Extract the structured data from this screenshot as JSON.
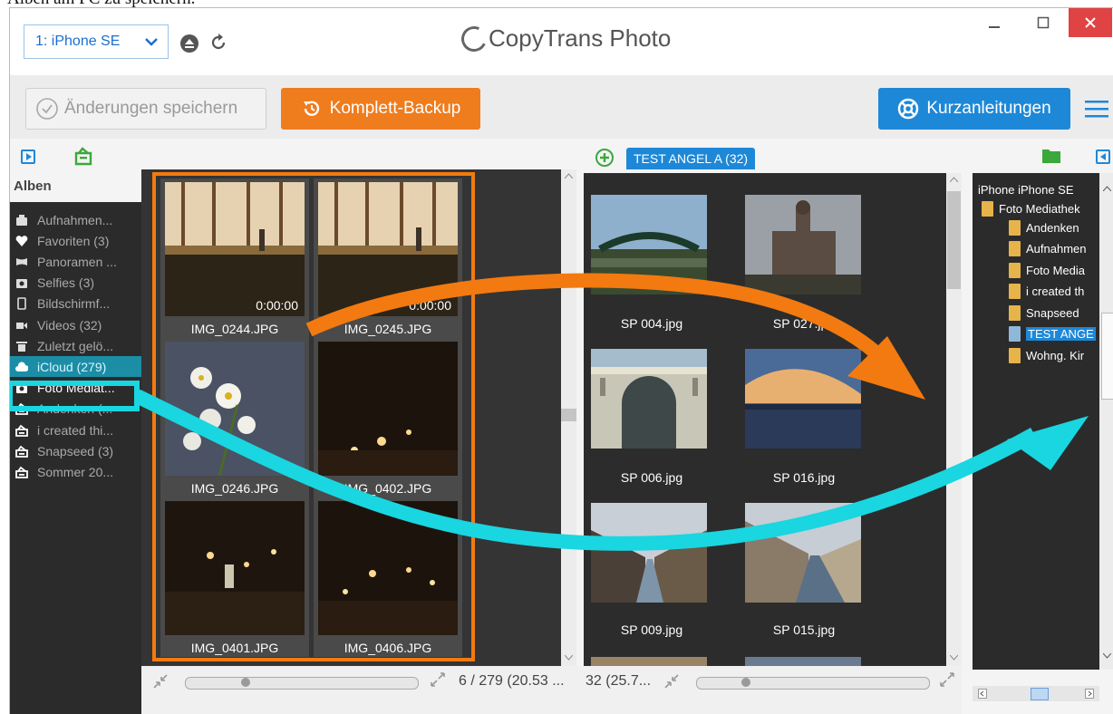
{
  "caption": "Alben am PC zu speichern.",
  "device": {
    "selected": "1: iPhone SE"
  },
  "app_title": "CopyTrans Photo",
  "window_controls": {
    "minimize": "–",
    "maximize": "☐",
    "close": "✕"
  },
  "toolbar": {
    "save_label": "Änderungen speichern",
    "backup_label": "Komplett-Backup",
    "guides_label": "Kurzanleitungen"
  },
  "sidebar": {
    "heading": "Alben",
    "items": [
      {
        "label": "Aufnahmen...",
        "icon": "camera-roll-icon"
      },
      {
        "label": "Favoriten (3)",
        "icon": "heart-icon"
      },
      {
        "label": "Panoramen ...",
        "icon": "panorama-icon"
      },
      {
        "label": "Selfies (3)",
        "icon": "selfie-camera-icon"
      },
      {
        "label": "Bildschirmf...",
        "icon": "phone-screenshot-icon"
      },
      {
        "label": "Videos (32)",
        "icon": "video-camera-icon"
      },
      {
        "label": "Zuletzt gelö...",
        "icon": "trash-icon"
      },
      {
        "label": "iCloud (279)",
        "icon": "cloud-icon"
      },
      {
        "label": "Foto Mediat...",
        "icon": "camera-icon"
      },
      {
        "label": "Andenken (...",
        "icon": "album-icon"
      },
      {
        "label": "i created thi...",
        "icon": "album-icon"
      },
      {
        "label": "Snapseed (3)",
        "icon": "album-icon"
      },
      {
        "label": "Sommer 20...",
        "icon": "album-icon"
      }
    ]
  },
  "left_grid": {
    "thumbs": [
      {
        "name": "IMG_0244.JPG",
        "duration": "0:00:00"
      },
      {
        "name": "IMG_0245.JPG",
        "duration": "0:00:00"
      },
      {
        "name": "IMG_0246.JPG",
        "duration": ""
      },
      {
        "name": "IMG_0402.JPG",
        "duration": ""
      },
      {
        "name": "IMG_0401.JPG",
        "duration": ""
      },
      {
        "name": "IMG_0406.JPG",
        "duration": ""
      }
    ],
    "status": "6 / 279 (20.53 ...",
    "zoom": 0.25
  },
  "right_panel": {
    "tab_label": "TEST ANGEL A (32)",
    "thumbs": [
      {
        "name": "SP 004.jpg"
      },
      {
        "name": "SP 027.jpg"
      },
      {
        "name": "SP 006.jpg"
      },
      {
        "name": "SP 016.jpg"
      },
      {
        "name": "SP 009.jpg"
      },
      {
        "name": "SP 015.jpg"
      }
    ],
    "status": "32 (25.7...",
    "zoom": 0.2
  },
  "tree": {
    "root": "iPhone iPhone SE",
    "library": "Foto Mediathek",
    "albums": [
      "Andenken",
      "Aufnahmen",
      "Foto Media",
      "i created th",
      "Snapseed",
      "TEST ANGE",
      "Wohng. Kir"
    ],
    "selected": "TEST ANGE"
  },
  "colors": {
    "accent_orange": "#ef7c1d",
    "accent_blue": "#1e88d8",
    "highlight_cyan": "#19d6e0"
  }
}
